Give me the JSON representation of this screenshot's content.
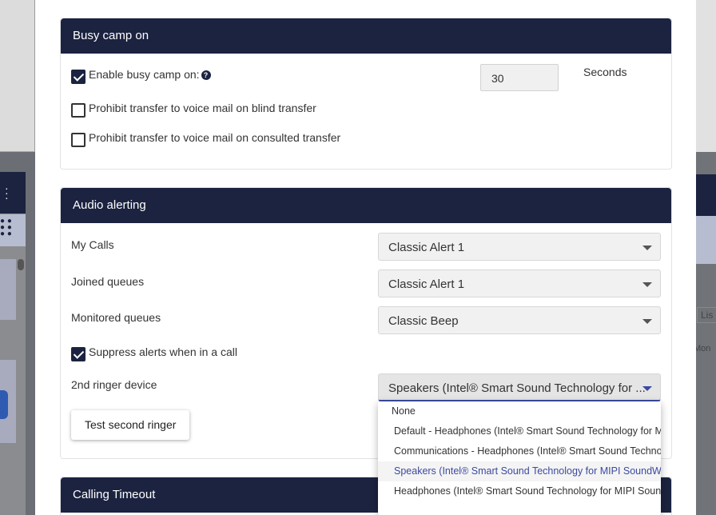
{
  "busy_camp_on": {
    "title": "Busy camp on",
    "enable_label": "Enable busy camp on:",
    "enable_checked": true,
    "seconds_value": "30",
    "seconds_unit": "Seconds",
    "prohibit_blind_label": "Prohibit transfer to voice mail on blind transfer",
    "prohibit_blind_checked": false,
    "prohibit_consulted_label": "Prohibit transfer to voice mail on consulted transfer",
    "prohibit_consulted_checked": false
  },
  "audio_alerting": {
    "title": "Audio alerting",
    "my_calls_label": "My Calls",
    "my_calls_value": "Classic Alert 1",
    "joined_queues_label": "Joined queues",
    "joined_queues_value": "Classic Alert 1",
    "monitored_queues_label": "Monitored queues",
    "monitored_queues_value": "Classic Beep",
    "suppress_label": "Suppress alerts when in a call",
    "suppress_checked": true,
    "second_ringer_label": "2nd ringer device",
    "second_ringer_value": "Speakers (Intel® Smart Sound Technology for ...",
    "test_button": "Test second ringer"
  },
  "ringer_dropdown": {
    "options": [
      "None",
      "Default - Headphones (Intel® Smart Sound Technology for MIPI SoundWire Audio)",
      "Communications - Headphones (Intel® Smart Sound Technology for MIPI SoundWire Audio)",
      "Speakers (Intel® Smart Sound Technology for MIPI SoundWire Audio)",
      "Headphones (Intel® Smart Sound Technology for MIPI SoundWire Audio)"
    ],
    "selected_index": 3
  },
  "calling_timeout": {
    "title": "Calling Timeout"
  },
  "background": {
    "right_tab_text": "Lis",
    "right_day_text": "Mon"
  },
  "colors": {
    "header_navy": "#1b2340",
    "accent_blue": "#3b4aa0"
  }
}
